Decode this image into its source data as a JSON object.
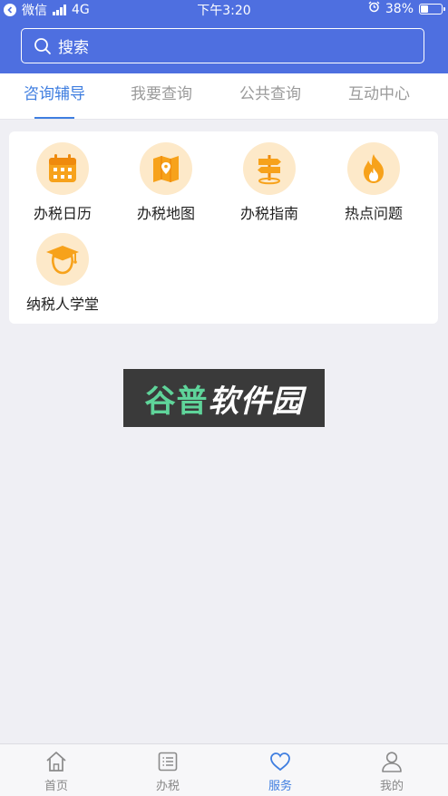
{
  "status_bar": {
    "carrier": "微信",
    "network": "4G",
    "time": "下午3:20",
    "battery": "38%",
    "battery_level": 0.38
  },
  "search": {
    "placeholder": "搜索"
  },
  "tabs": [
    {
      "label": "咨询辅导",
      "active": true
    },
    {
      "label": "我要查询",
      "active": false
    },
    {
      "label": "公共查询",
      "active": false
    },
    {
      "label": "互动中心",
      "active": false
    }
  ],
  "grid": [
    {
      "label": "办税日历",
      "icon": "calendar-icon"
    },
    {
      "label": "办税地图",
      "icon": "map-icon"
    },
    {
      "label": "办税指南",
      "icon": "signpost-icon"
    },
    {
      "label": "热点问题",
      "icon": "fire-icon"
    },
    {
      "label": "纳税人学堂",
      "icon": "graduation-cap-icon"
    }
  ],
  "watermark": {
    "part1": "谷普",
    "part2": "软件园"
  },
  "bottom_nav": [
    {
      "label": "首页",
      "icon": "home-icon",
      "active": false
    },
    {
      "label": "办税",
      "icon": "list-icon",
      "active": false
    },
    {
      "label": "服务",
      "icon": "heart-icon",
      "active": true
    },
    {
      "label": "我的",
      "icon": "user-icon",
      "active": false
    }
  ],
  "colors": {
    "header": "#4e6fe0",
    "accent": "#3f7ee0",
    "icon_orange": "#f7a21b",
    "icon_bg": "#fde9c9"
  }
}
